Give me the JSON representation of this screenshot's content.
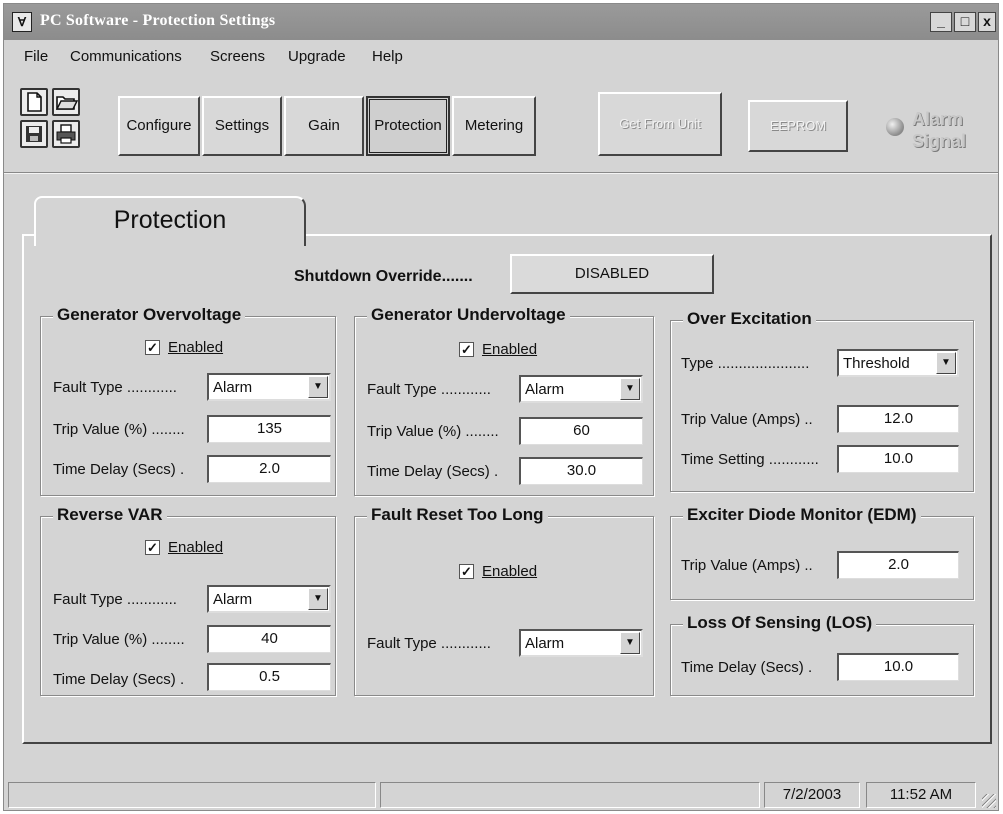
{
  "window": {
    "title": "PC Software - Protection Settings",
    "icon": "app-logo-icon",
    "controls": {
      "minimize": "_",
      "maximize": "□",
      "close": "x"
    }
  },
  "menu": {
    "items": [
      {
        "label": "File"
      },
      {
        "label": "Communications"
      },
      {
        "label": "Screens"
      },
      {
        "label": "Upgrade"
      },
      {
        "label": "Help"
      }
    ]
  },
  "toolbar": {
    "icons": [
      "new-file-icon",
      "open-folder-icon",
      "save-disk-icon",
      "print-icon"
    ],
    "buttons": {
      "configure": "Configure",
      "settings": "Settings",
      "gain": "Gain",
      "protection": "Protection",
      "metering": "Metering",
      "get_from_unit": "Get From Unit",
      "eeprom": "EEPROM"
    },
    "alarm_signal": "Alarm Signal"
  },
  "tab": {
    "label": "Protection"
  },
  "shutdown": {
    "label": "Shutdown Override.......",
    "value": "DISABLED"
  },
  "generator_overvoltage": {
    "title": "Generator Overvoltage",
    "enabled_label": "Enabled",
    "enabled": true,
    "fault_type_label": "Fault Type ............",
    "fault_type": "Alarm",
    "trip_value_label": "Trip Value (%) ........",
    "trip_value": "135",
    "time_delay_label": "Time Delay (Secs) .",
    "time_delay": "2.0"
  },
  "generator_undervoltage": {
    "title": "Generator Undervoltage",
    "enabled_label": "Enabled",
    "enabled": true,
    "fault_type_label": "Fault Type ............",
    "fault_type": "Alarm",
    "trip_value_label": "Trip Value (%) ........",
    "trip_value": "60",
    "time_delay_label": "Time Delay (Secs) .",
    "time_delay": "30.0"
  },
  "over_excitation": {
    "title": "Over Excitation",
    "type_label": "Type ......................",
    "type": "Threshold",
    "trip_value_label": "Trip Value (Amps) ..",
    "trip_value": "12.0",
    "time_setting_label": "Time Setting ............",
    "time_setting": "10.0"
  },
  "reverse_var": {
    "title": "Reverse VAR",
    "enabled_label": "Enabled",
    "enabled": true,
    "fault_type_label": "Fault Type ............",
    "fault_type": "Alarm",
    "trip_value_label": "Trip Value (%) ........",
    "trip_value": "40",
    "time_delay_label": "Time Delay (Secs) .",
    "time_delay": "0.5"
  },
  "fault_reset": {
    "title": "Fault Reset Too Long",
    "enabled_label": "Enabled",
    "enabled": true,
    "fault_type_label": "Fault Type ............",
    "fault_type": "Alarm"
  },
  "edm": {
    "title": "Exciter Diode Monitor (EDM)",
    "trip_value_label": "Trip Value (Amps) ..",
    "trip_value": "2.0"
  },
  "los": {
    "title": "Loss Of Sensing (LOS)",
    "time_delay_label": "Time Delay (Secs) .",
    "time_delay": "10.0"
  },
  "status": {
    "date": "7/2/2003",
    "time": "11:52 AM"
  }
}
